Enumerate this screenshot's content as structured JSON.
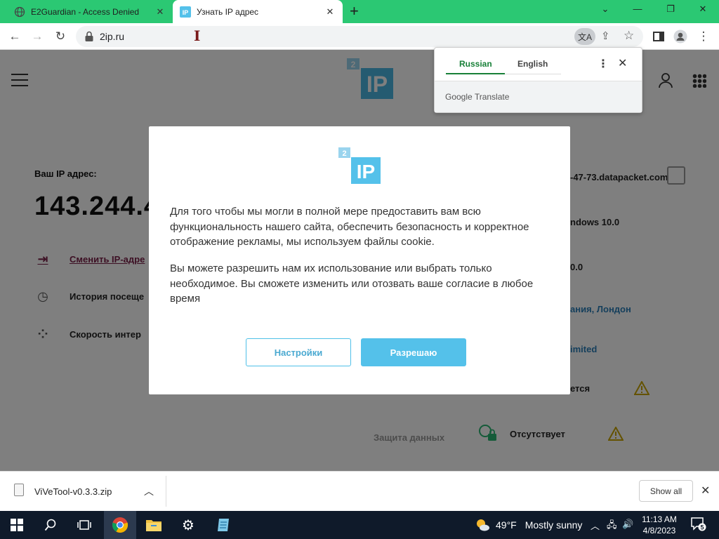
{
  "browser": {
    "tabs": [
      {
        "title": "E2Guardian - Access Denied"
      },
      {
        "title": "Узнать IP адрес"
      }
    ],
    "url": "2ip.ru"
  },
  "translate_popup": {
    "lang_source": "Russian",
    "lang_target": "English",
    "footer": "Google Translate"
  },
  "page": {
    "ip_label": "Ваш IP адрес:",
    "ip_value": "143.244.4",
    "links": {
      "change_ip": "Сменить IP-адре",
      "history": "История посеще",
      "speed": "Скорость интер"
    },
    "info": {
      "host": "-47-73.datapacket.com",
      "os": "ndows 10.0",
      "browser": "0.0",
      "location": "ания, Лондон",
      "provider": "imited",
      "proxy": "ется",
      "data_protection_label": "Защита данных",
      "data_protection_value": "Отсутствует"
    }
  },
  "cookie_modal": {
    "logo_badge": "2",
    "logo_text": "IP",
    "paragraph1": "Для того чтобы мы могли в полной мере предоставить вам всю функциональность нашего сайта, обеспечить безопасность и корректное отображение рекламы, мы используем файлы cookie.",
    "paragraph2": "Вы можете разрешить нам их использование или выбрать только необходимое. Вы сможете изменить или отозвать ваше согласие в любое время",
    "settings_button": "Настройки",
    "allow_button": "Разрешаю"
  },
  "download_bar": {
    "filename": "ViVeTool-v0.3.3.zip",
    "show_all": "Show all"
  },
  "taskbar": {
    "weather_temp": "49°F",
    "weather_text": "Mostly sunny",
    "time": "11:13 AM",
    "date": "4/8/2023",
    "notification_count": "5"
  },
  "colors": {
    "tabstrip": "#2bc873",
    "brand_blue": "#54c1ea",
    "link_purple": "#7a2048",
    "translate_green": "#188038",
    "taskbar": "#0f1a2a"
  }
}
